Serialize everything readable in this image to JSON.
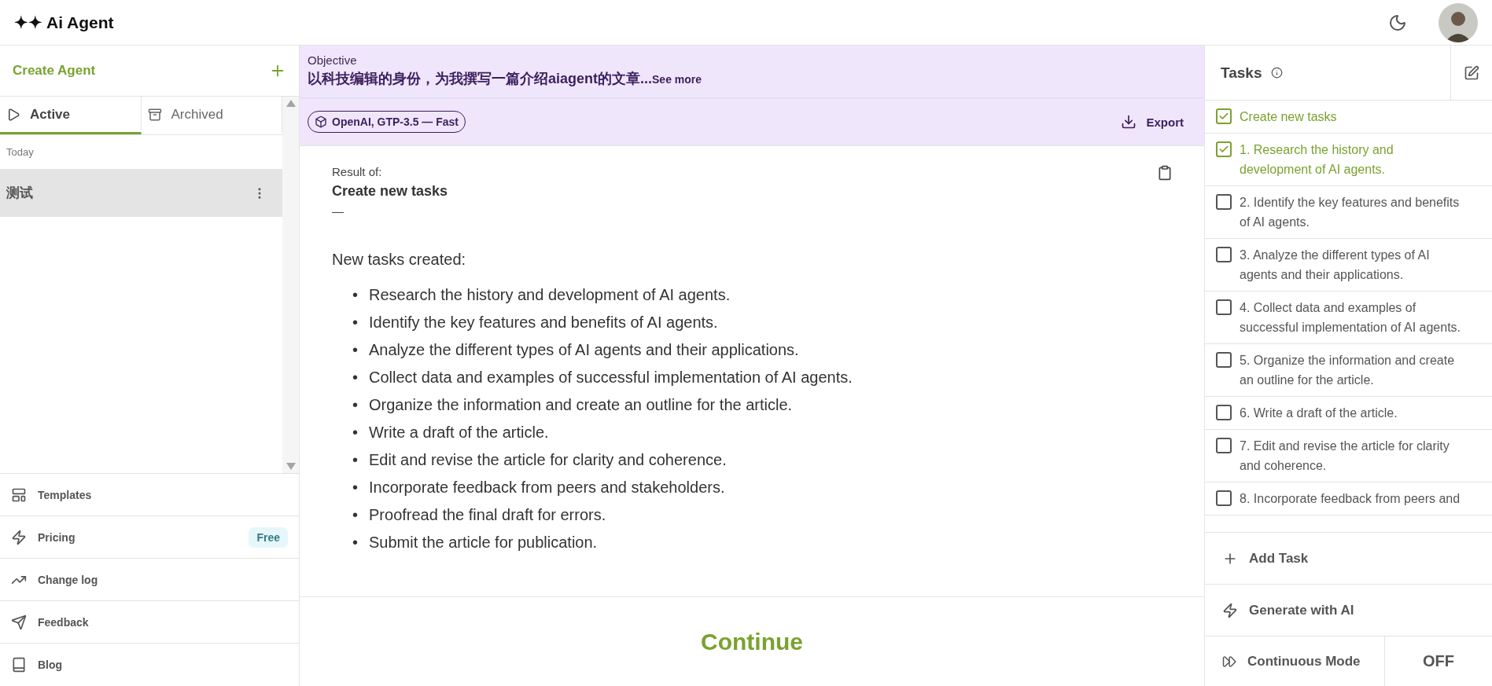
{
  "header": {
    "logo": "✦✦ Ai Agent"
  },
  "sidebar": {
    "create_label": "Create Agent",
    "tabs": [
      {
        "label": "Active",
        "kind": "active",
        "selected": true
      },
      {
        "label": "Archived",
        "kind": "archived",
        "selected": false
      }
    ],
    "group_label": "Today",
    "agents": [
      {
        "name": "测试",
        "selected": true
      }
    ],
    "nav": [
      {
        "label": "Templates",
        "kind": "templates"
      },
      {
        "label": "Pricing",
        "kind": "pricing",
        "badge": "Free"
      },
      {
        "label": "Change log",
        "kind": "changelog"
      },
      {
        "label": "Feedback",
        "kind": "feedback"
      },
      {
        "label": "Blog",
        "kind": "blog"
      }
    ]
  },
  "objective": {
    "label": "Objective",
    "text": "以科技编辑的身份，为我撰写一篇介绍aiagent的文章...",
    "see_more": "See more",
    "model": "OpenAI, GTP-3.5 — Fast",
    "export": "Export"
  },
  "result": {
    "label": "Result of:",
    "title": "Create new tasks",
    "dash": "—",
    "intro": "New tasks created:",
    "bullet": "•",
    "items": [
      "Research the history and development of AI agents.",
      "Identify the key features and benefits of AI agents.",
      "Analyze the different types of AI agents and their applications.",
      "Collect data and examples of successful implementation of AI agents.",
      "Organize the information and create an outline for the article.",
      "Write a draft of the article.",
      "Edit and revise the article for clarity and coherence.",
      "Incorporate feedback from peers and stakeholders.",
      "Proofread the final draft for errors.",
      "Submit the article for publication."
    ]
  },
  "continue_button": "Continue",
  "tasks": {
    "title": "Tasks",
    "items": [
      {
        "text": "Create new tasks",
        "checked": true
      },
      {
        "text": "1. Research the history and development of AI agents.",
        "checked": true
      },
      {
        "text": "2. Identify the key features and benefits of AI agents.",
        "checked": false
      },
      {
        "text": "3. Analyze the different types of AI agents and their applications.",
        "checked": false
      },
      {
        "text": "4. Collect data and examples of successful implementation of AI agents.",
        "checked": false
      },
      {
        "text": "5. Organize the information and create an outline for the article.",
        "checked": false
      },
      {
        "text": "6. Write a draft of the article.",
        "checked": false
      },
      {
        "text": "7. Edit and revise the article for clarity and coherence.",
        "checked": false
      },
      {
        "text": "8. Incorporate feedback from peers and",
        "checked": false
      }
    ],
    "add_task": "Add Task",
    "generate": "Generate with AI",
    "continuous_mode": "Continuous Mode",
    "continuous_state": "OFF"
  }
}
